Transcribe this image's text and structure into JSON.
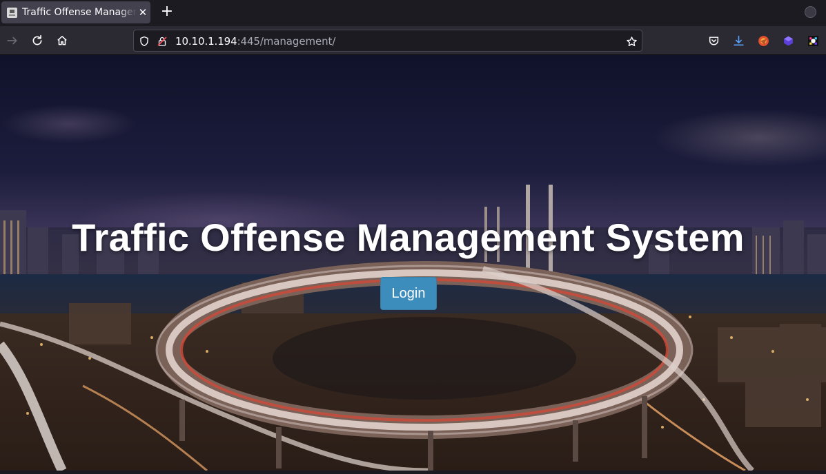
{
  "browser": {
    "tab": {
      "title": "Traffic Offense Management System",
      "close_icon": "close-icon"
    },
    "new_tab_icon": "plus-icon",
    "url": {
      "host": "10.10.1.194",
      "rest": ":445/management/"
    },
    "nav_icons": [
      "arrow-right-icon",
      "reload-icon",
      "home-icon"
    ],
    "url_icons": [
      "shield-icon",
      "insecure-lock-icon",
      "star-icon"
    ],
    "toolbar_icons": [
      "pocket-icon",
      "download-icon",
      "extension-fox-icon",
      "extension-cube-icon",
      "extension-color-icon"
    ]
  },
  "page": {
    "title": "Traffic Offense Management System",
    "login_label": "Login",
    "colors": {
      "button": "#3c8dbc",
      "title": "#ffffff"
    }
  }
}
